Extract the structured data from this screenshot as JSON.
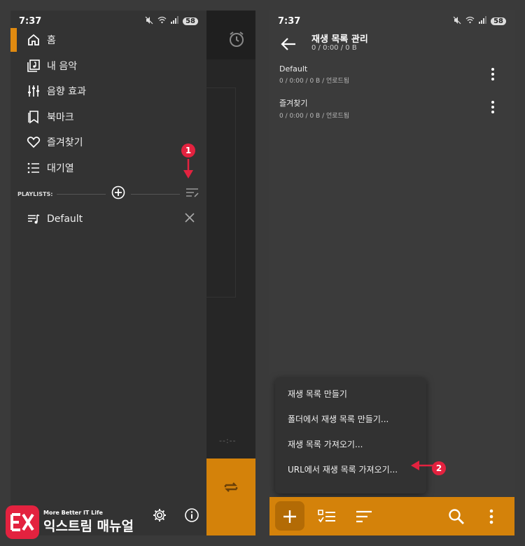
{
  "left_phone": {
    "status": {
      "time": "7:37",
      "battery": "58"
    },
    "nav": [
      {
        "label": "홈"
      },
      {
        "label": "내 음악"
      },
      {
        "label": "음향 효과"
      },
      {
        "label": "북마크"
      },
      {
        "label": "즐겨찾기"
      },
      {
        "label": "대기열"
      }
    ],
    "playlists_label": "PLAYLISTS:",
    "playlist_default": "Default",
    "callout_1": "1",
    "bg_time": "--:--"
  },
  "right_phone": {
    "status": {
      "time": "7:37",
      "battery": "58"
    },
    "header": {
      "title": "재생 목록 관리",
      "subtitle": "0 / 0:00 / 0 B"
    },
    "playlists": [
      {
        "name": "Default",
        "meta": "0 / 0:00 / 0 B / 언로드됨"
      },
      {
        "name": "즐겨찾기",
        "meta": "0 / 0:00 / 0 B / 언로드됨"
      }
    ],
    "menu": [
      {
        "label": "재생 목록 만들기"
      },
      {
        "label": "폴더에서 재생 목록 만들기..."
      },
      {
        "label": "재생 목록 가져오기..."
      },
      {
        "label": "URL에서 재생 목록 가져오기..."
      }
    ],
    "callout_2": "2"
  },
  "logo": {
    "small": "More Better IT Life",
    "big": "익스트림 매뉴얼"
  },
  "colors": {
    "accent": "#d4820a",
    "callout": "#e3223f"
  }
}
